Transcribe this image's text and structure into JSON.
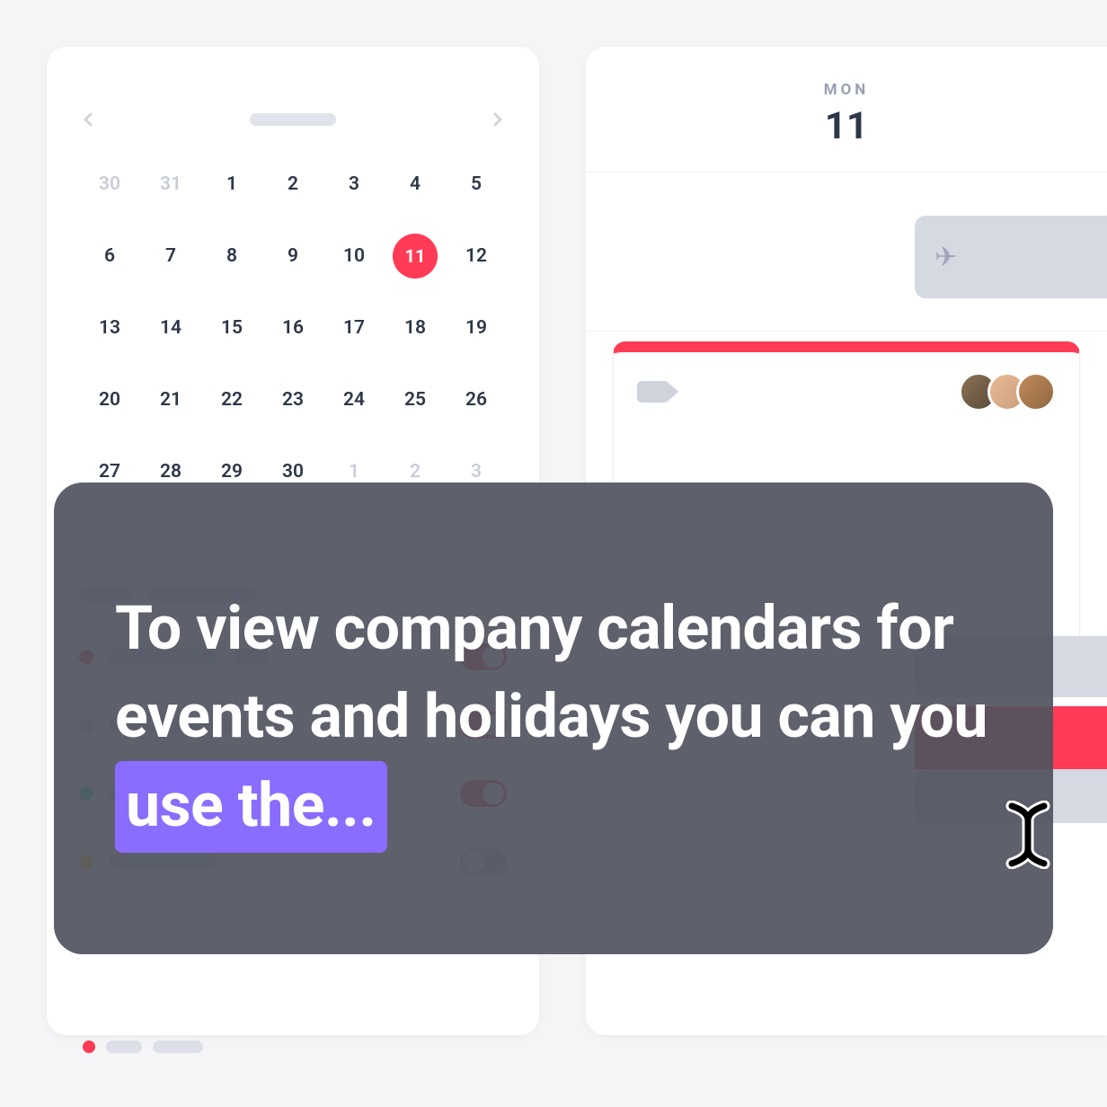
{
  "calendar": {
    "weeks": [
      [
        {
          "d": "30",
          "outside": true
        },
        {
          "d": "31",
          "outside": true
        },
        {
          "d": "1"
        },
        {
          "d": "2"
        },
        {
          "d": "3"
        },
        {
          "d": "4"
        },
        {
          "d": "5"
        }
      ],
      [
        {
          "d": "6"
        },
        {
          "d": "7"
        },
        {
          "d": "8"
        },
        {
          "d": "9"
        },
        {
          "d": "10"
        },
        {
          "d": "11",
          "selected": true
        },
        {
          "d": "12"
        }
      ],
      [
        {
          "d": "13"
        },
        {
          "d": "14"
        },
        {
          "d": "15"
        },
        {
          "d": "16"
        },
        {
          "d": "17"
        },
        {
          "d": "18"
        },
        {
          "d": "19"
        }
      ],
      [
        {
          "d": "20"
        },
        {
          "d": "21"
        },
        {
          "d": "22"
        },
        {
          "d": "23"
        },
        {
          "d": "24"
        },
        {
          "d": "25"
        },
        {
          "d": "26"
        }
      ],
      [
        {
          "d": "27"
        },
        {
          "d": "28"
        },
        {
          "d": "29"
        },
        {
          "d": "30"
        },
        {
          "d": "1",
          "outside": true
        },
        {
          "d": "2",
          "outside": true
        },
        {
          "d": "3",
          "outside": true
        }
      ]
    ]
  },
  "day": {
    "abbr": "MON",
    "num": "11"
  },
  "overlay": {
    "line_pre": "To view company calendars for events and holidays you can you ",
    "highlight": "use the...",
    "line_post": ""
  }
}
